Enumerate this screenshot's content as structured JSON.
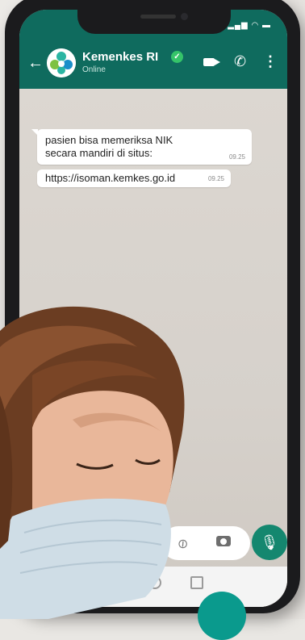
{
  "header": {
    "contact_name": "Kemenkes RI",
    "contact_status": "Online"
  },
  "messages": [
    {
      "text": "pasien bisa memeriksa NIK secara mandiri di situs:",
      "time": "09.25"
    },
    {
      "text": "https://isoman.kemkes.go.id",
      "time": "09.25"
    }
  ],
  "colors": {
    "header": "#0f6b5e",
    "accent": "#14876f",
    "verified": "#35c469"
  }
}
